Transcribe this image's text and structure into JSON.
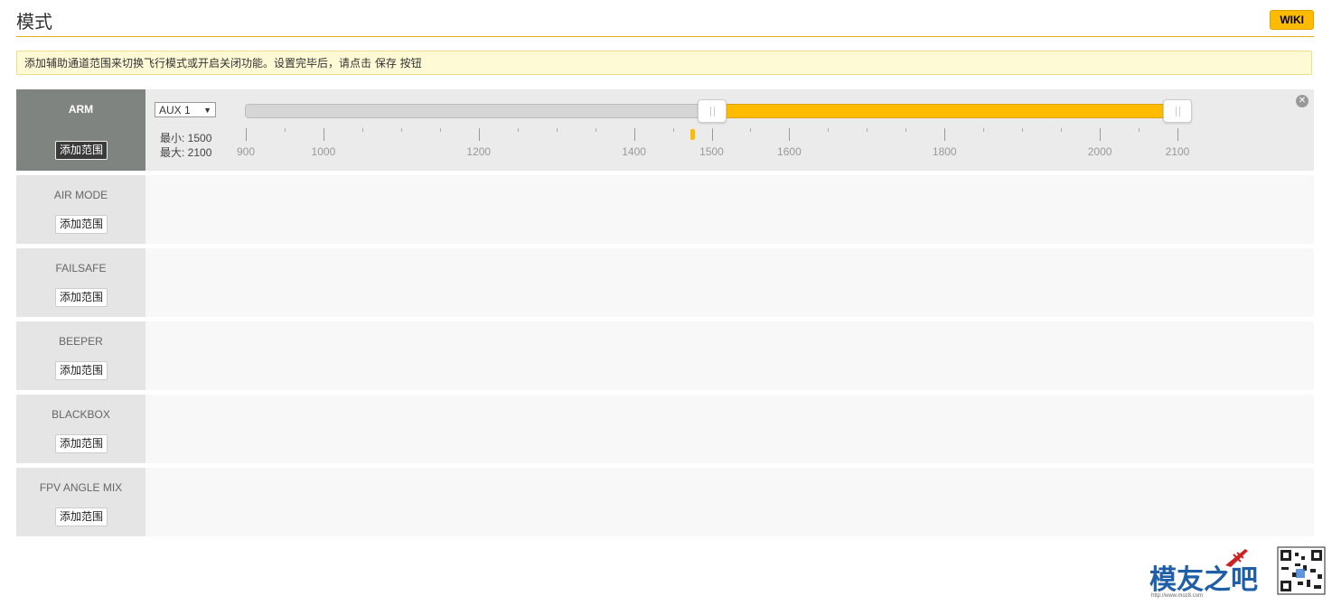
{
  "page": {
    "title": "模式",
    "wiki_label": "WIKI"
  },
  "note": "添加辅助通道范围来切换飞行模式或开启关闭功能。设置完毕后，请点击 保存 按钮",
  "modes": [
    {
      "name": "ARM",
      "add_label": "添加范围",
      "active": true,
      "range": {
        "channel": "AUX 1",
        "min_label": "最小: 1500",
        "max_label": "最大: 2100",
        "min": 1500,
        "max": 2100,
        "current": 1475,
        "scale_min": 900,
        "scale_max": 2100,
        "tick_labels": [
          "900",
          "1000",
          "1200",
          "1400",
          "1500",
          "1600",
          "1800",
          "2000",
          "2100"
        ],
        "remove_icon": "close-icon"
      }
    },
    {
      "name": "AIR MODE",
      "add_label": "添加范围"
    },
    {
      "name": "FAILSAFE",
      "add_label": "添加范围"
    },
    {
      "name": "BEEPER",
      "add_label": "添加范围"
    },
    {
      "name": "BLACKBOX",
      "add_label": "添加范围"
    },
    {
      "name": "FPV ANGLE MIX",
      "add_label": "添加范围"
    }
  ],
  "colors": {
    "accent": "#ffbb00",
    "active_mode": "#808480",
    "header_line": "#e3b01c"
  },
  "watermark": {
    "brand": "模友之吧",
    "url": "http://www.moz8.com"
  }
}
